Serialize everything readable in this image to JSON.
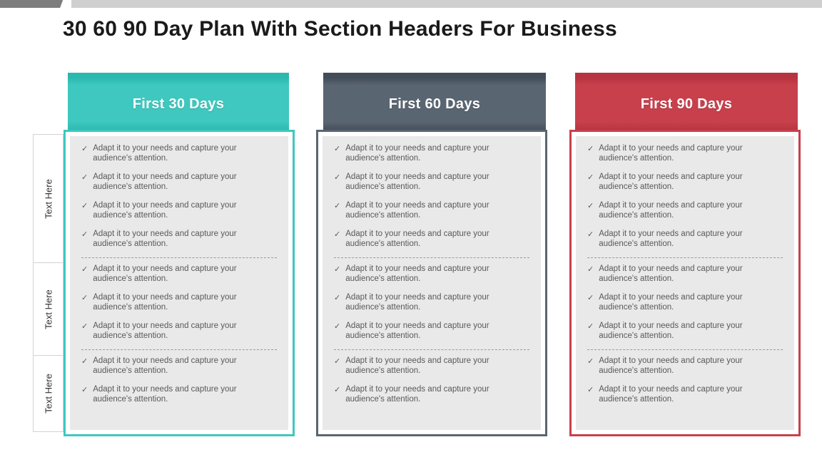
{
  "page": {
    "title": "30 60 90 Day Plan With Section Headers For Business"
  },
  "theme": {
    "teal": "#3ec8bf",
    "teal_dark": "#2bb8ae",
    "slate": "#5a6572",
    "slate_dark": "#434d59",
    "red": "#c8404c",
    "red_dark": "#b63340",
    "body_gray": "#e9e9e9",
    "text_gray": "#595959",
    "topbar_dark": "#7d7d7d",
    "topbar_light": "#cfcfcf"
  },
  "topbar": {
    "left_label": "",
    "right_label": ""
  },
  "rail": {
    "items": [
      {
        "label": "Text Here"
      },
      {
        "label": "Text Here"
      },
      {
        "label": "Text Here"
      }
    ]
  },
  "bullet_text": "Adapt it to your needs and capture your audience's attention.",
  "check_icon": "✓",
  "cards": [
    {
      "title": "First 30 Days",
      "accent": "#3ec8bf",
      "accent_dark": "#2bb8ae",
      "groups": [
        {
          "bullets": [
            "Adapt it to your needs and capture your audience's attention.",
            "Adapt it to your needs and capture your audience's attention.",
            "Adapt it to your needs and capture your audience's attention.",
            "Adapt it to your needs and capture your audience's attention."
          ]
        },
        {
          "bullets": [
            "Adapt it to your needs and capture your audience's attention.",
            "Adapt it to your needs and capture your audience's attention.",
            "Adapt it to your needs and capture your audience's attention."
          ]
        },
        {
          "bullets": [
            "Adapt it to your needs and capture your audience's attention.",
            "Adapt it to your needs and capture your audience's attention."
          ]
        }
      ]
    },
    {
      "title": "First 60 Days",
      "accent": "#5a6572",
      "accent_dark": "#434d59",
      "groups": [
        {
          "bullets": [
            "Adapt it to your needs and capture your audience's attention.",
            "Adapt it to your needs and capture your audience's attention.",
            "Adapt it to your needs and capture your audience's attention.",
            "Adapt it to your needs and capture your audience's attention."
          ]
        },
        {
          "bullets": [
            "Adapt it to your needs and capture your audience's attention.",
            "Adapt it to your needs and capture your audience's attention.",
            "Adapt it to your needs and capture your audience's attention."
          ]
        },
        {
          "bullets": [
            "Adapt it to your needs and capture your audience's attention.",
            "Adapt it to your needs and capture your audience's attention."
          ]
        }
      ]
    },
    {
      "title": "First 90 Days",
      "accent": "#c8404c",
      "accent_dark": "#b63340",
      "groups": [
        {
          "bullets": [
            "Adapt it to your needs and capture your audience's attention.",
            "Adapt it to your needs and capture your audience's attention.",
            "Adapt it to your needs and capture your audience's attention.",
            "Adapt it to your needs and capture your audience's attention."
          ]
        },
        {
          "bullets": [
            "Adapt it to your needs and capture your audience's attention.",
            "Adapt it to your needs and capture your audience's attention.",
            "Adapt it to your needs and capture your audience's attention."
          ]
        },
        {
          "bullets": [
            "Adapt it to your needs and capture your audience's attention.",
            "Adapt it to your needs and capture your audience's attention."
          ]
        }
      ]
    }
  ]
}
